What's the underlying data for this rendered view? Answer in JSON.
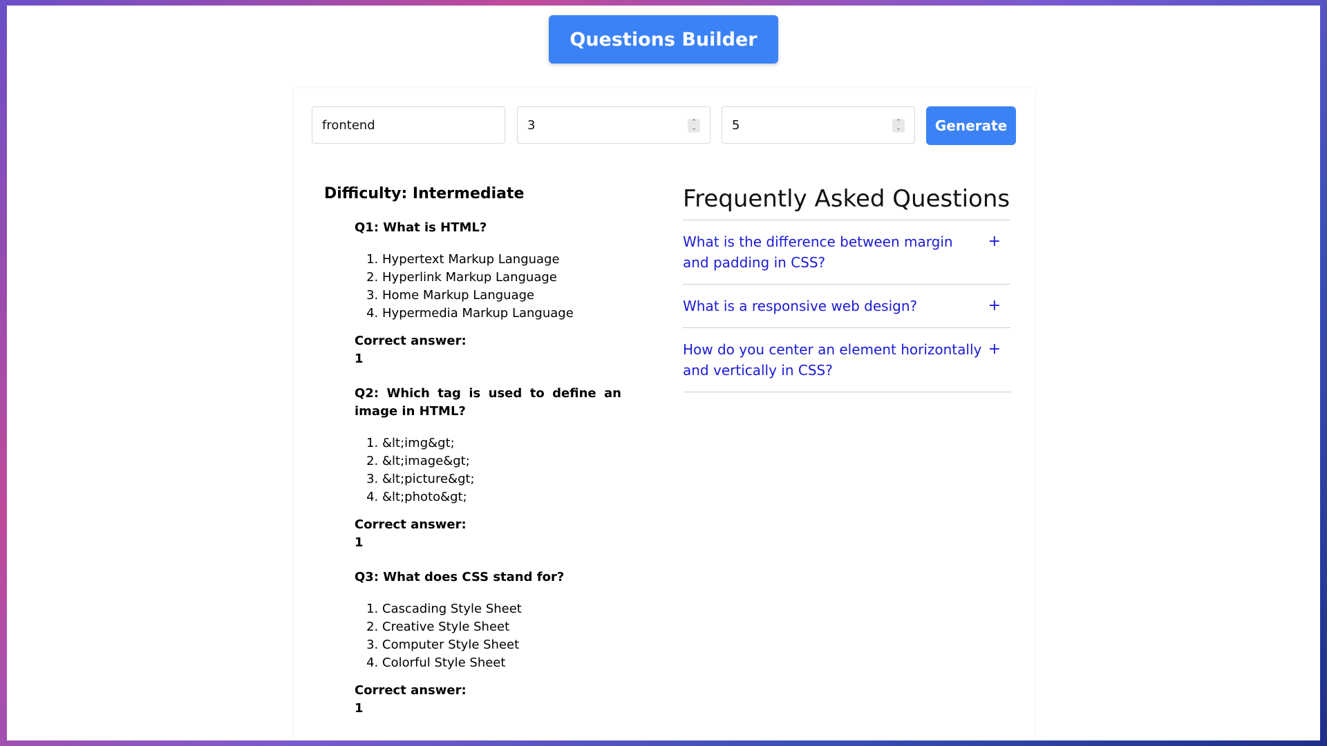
{
  "header": {
    "title": "Questions Builder"
  },
  "controls": {
    "topic_value": "frontend",
    "num_questions_value": "3",
    "num_options_value": "5",
    "generate_label": "Generate"
  },
  "quiz": {
    "difficulty": "Difficulty: Intermediate",
    "correct_label": "Correct answer:",
    "questions": [
      {
        "title": "Q1: What is HTML?",
        "options": [
          "Hypertext Markup Language",
          "Hyperlink Markup Language",
          "Home Markup Language",
          "Hypermedia Markup Language"
        ],
        "answer": "1"
      },
      {
        "title": "Q2: Which tag is used to define an image in HTML?",
        "options": [
          "&lt;img&gt;",
          "&lt;image&gt;",
          "&lt;picture&gt;",
          "&lt;photo&gt;"
        ],
        "answer": "1"
      },
      {
        "title": "Q3: What does CSS stand for?",
        "options": [
          "Cascading Style Sheet",
          "Creative Style Sheet",
          "Computer Style Sheet",
          "Colorful Style Sheet"
        ],
        "answer": "1"
      }
    ]
  },
  "faq": {
    "title": "Frequently Asked Questions",
    "expand_glyph": "+",
    "items": [
      "What is the difference between margin and padding in CSS?",
      "What is a responsive web design?",
      "How do you center an element horizontally and vertically in CSS?"
    ]
  },
  "icons": {
    "spinner": "spinner-icon",
    "expand": "plus-icon"
  },
  "colors": {
    "primary": "#3b82f6",
    "link": "#1a1ad6"
  }
}
